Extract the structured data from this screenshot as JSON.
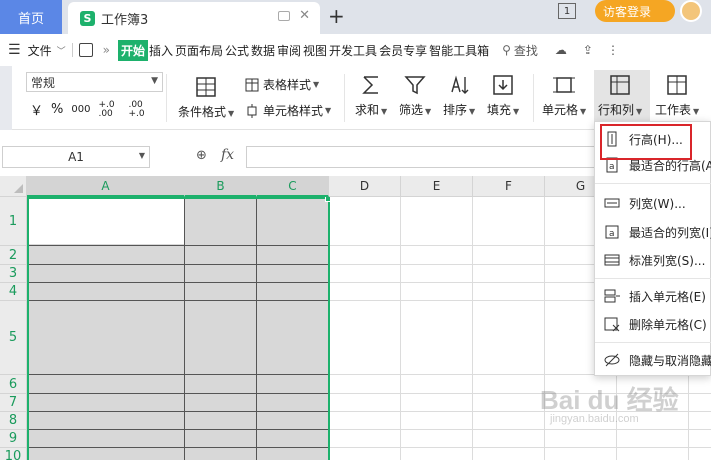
{
  "tabs": {
    "home": "首页",
    "doc_title": "工作簿3",
    "doc_icon_letter": "S",
    "new_tab": "+",
    "window_count": "1",
    "login": "访客登录"
  },
  "menu": {
    "file": "文件",
    "items": [
      "开始",
      "插入",
      "页面布局",
      "公式",
      "数据",
      "审阅",
      "视图",
      "开发工具",
      "会员专享",
      "智能工具箱"
    ],
    "search": "查找"
  },
  "ribbon": {
    "number_format": "常规",
    "currency": "￥",
    "percent": "%",
    "thousands": "000",
    "inc_decimal": "+.0 .00",
    "dec_decimal": ".00 +.0",
    "cond_format": "条件格式",
    "table_style": "表格样式",
    "cell_style": "单元格样式",
    "sum": "求和",
    "filter": "筛选",
    "sort": "排序",
    "fill": "填充",
    "cell": "单元格",
    "row_col": "行和列",
    "worksheet": "工作表"
  },
  "formula_bar": {
    "name_box": "A1",
    "fx": "fx",
    "content": ""
  },
  "grid": {
    "columns": [
      "A",
      "B",
      "C",
      "D",
      "E",
      "F",
      "G"
    ],
    "rows": [
      "1",
      "2",
      "3",
      "4",
      "5",
      "6",
      "7",
      "8",
      "9",
      "10"
    ]
  },
  "dropdown": {
    "items": [
      {
        "label": "行高(H)...",
        "icon": "row-height-icon"
      },
      {
        "label": "最适合的行高(A)",
        "icon": "fit-row-height-icon"
      },
      {
        "label": "列宽(W)...",
        "icon": "column-width-icon"
      },
      {
        "label": "最适合的列宽(I)",
        "icon": "fit-column-width-icon"
      },
      {
        "label": "标准列宽(S)...",
        "icon": "standard-width-icon"
      },
      {
        "label": "插入单元格(E)",
        "icon": "insert-cell-icon"
      },
      {
        "label": "删除单元格(C)",
        "icon": "delete-cell-icon"
      },
      {
        "label": "隐藏与取消隐藏",
        "icon": "hide-unhide-icon"
      }
    ]
  },
  "colors": {
    "accent": "#1db16c",
    "home_tab": "#5b87e6",
    "login": "#f5a623",
    "highlight": "#d9252a"
  },
  "watermark": {
    "main": "Bai du 经验",
    "sub": "jingyan.baidu.com"
  }
}
